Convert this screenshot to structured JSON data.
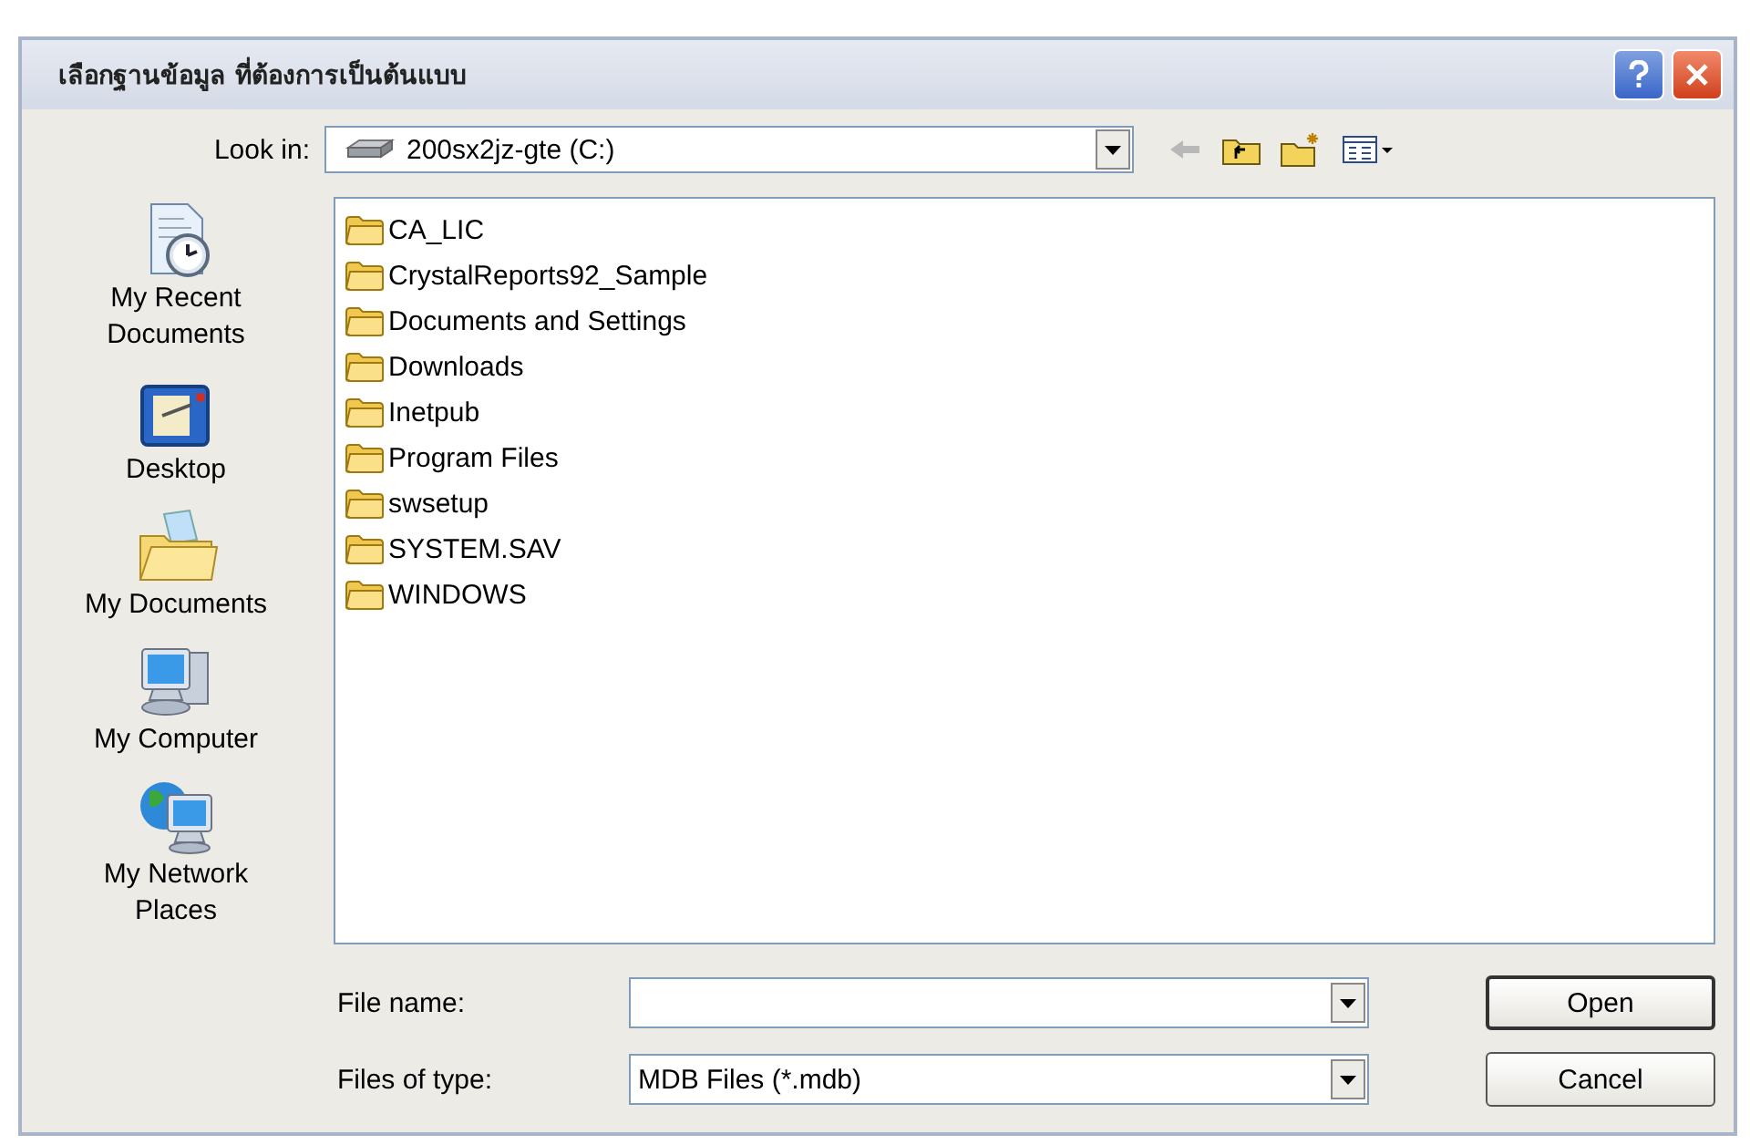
{
  "window": {
    "title": "เลือกฐานข้อมูล ที่ต้องการเป็นต้นแบบ"
  },
  "look_in": {
    "label": "Look in:",
    "value": "200sx2jz-gte (C:)"
  },
  "places": [
    {
      "label": "My Recent Documents",
      "kind": "recent"
    },
    {
      "label": "Desktop",
      "kind": "desktop"
    },
    {
      "label": "My Documents",
      "kind": "documents"
    },
    {
      "label": "My Computer",
      "kind": "computer"
    },
    {
      "label": "My Network Places",
      "kind": "network"
    }
  ],
  "files": [
    {
      "name": "CA_LIC"
    },
    {
      "name": "CrystalReports92_Sample"
    },
    {
      "name": "Documents and Settings"
    },
    {
      "name": "Downloads"
    },
    {
      "name": "Inetpub"
    },
    {
      "name": "Program Files"
    },
    {
      "name": "swsetup"
    },
    {
      "name": "SYSTEM.SAV"
    },
    {
      "name": "WINDOWS"
    }
  ],
  "file_name": {
    "label": "File name:"
  },
  "file_type": {
    "label": "Files of type:",
    "value": "MDB Files (*.mdb)"
  },
  "buttons": [
    "Open",
    "Cancel"
  ]
}
